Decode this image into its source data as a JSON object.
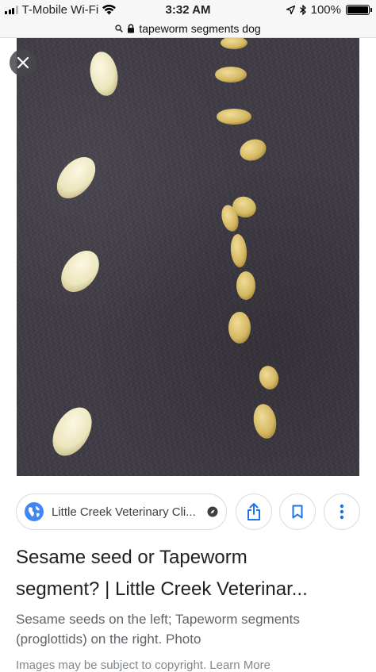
{
  "status_bar": {
    "carrier": "T-Mobile Wi-Fi",
    "time": "3:32 AM",
    "battery": "100%",
    "battery_level": 1.0
  },
  "url_bar": {
    "query": "tapeworm segments dog"
  },
  "result": {
    "source_name": "Little Creek Veterinary Cli...",
    "title_line1": "Sesame seed or Tapeworm",
    "title_line2": "segment? | Little Creek Veterinar...",
    "description_line1": "Sesame seeds on the left; Tapeworm segments",
    "description_line2": "(proglottids) on the right. Photo",
    "copyright": "Images may be subject to copyright. Learn More"
  },
  "icons": {
    "close": "close-icon",
    "share": "share-icon",
    "bookmark": "bookmark-icon",
    "more": "more-vert-icon",
    "globe": "globe-icon",
    "lock": "lock-icon",
    "search": "search-icon",
    "wifi": "wifi-icon",
    "location": "location-arrow-icon",
    "bluetooth": "bluetooth-icon"
  },
  "colors": {
    "accent": "#1a73e8",
    "photo_background": "#3f3b44",
    "sesame_seed": "#f1ecc6",
    "tapeworm_segment": "#dcc06e"
  }
}
